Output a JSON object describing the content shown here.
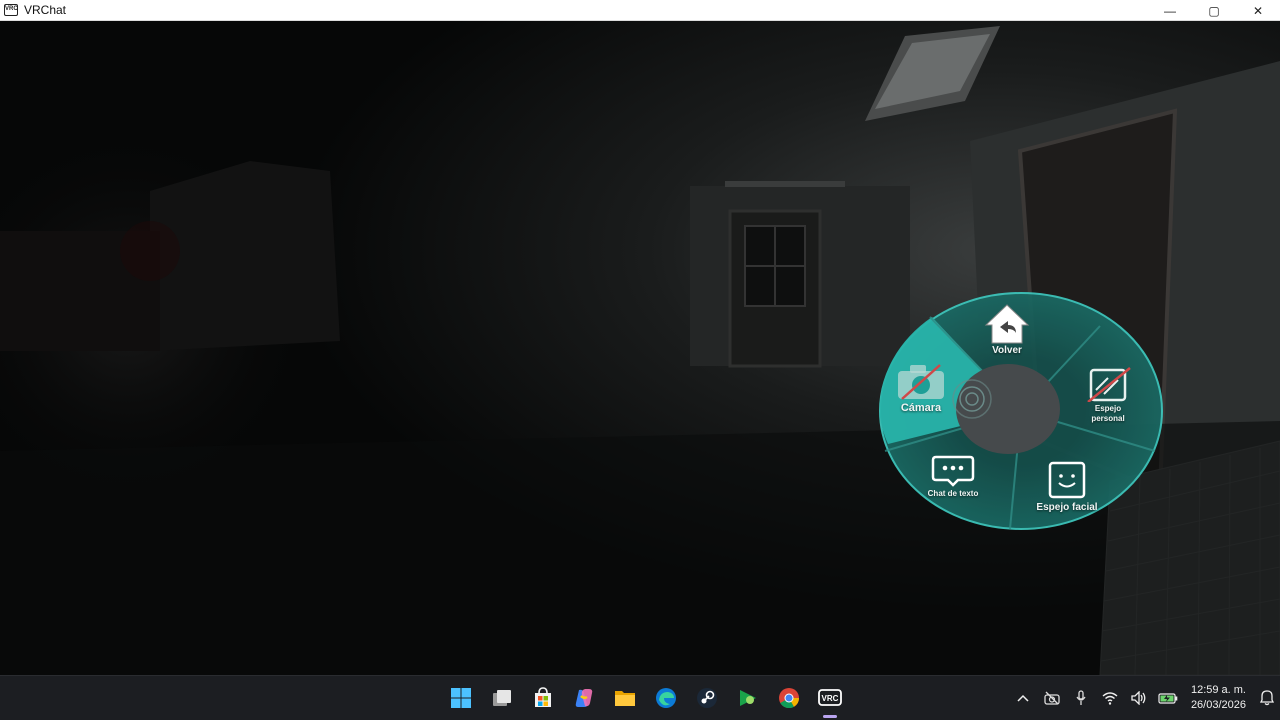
{
  "window": {
    "title": "VRChat",
    "icon_text": "VRC",
    "controls": {
      "minimize": "—",
      "maximize": "▢",
      "close": "✕"
    }
  },
  "radial_menu": {
    "accent_color": "#1f9e97",
    "items": {
      "back": "Volver",
      "camera": "Cámara",
      "personal_mirror_line1": "Espejo",
      "personal_mirror_line2": "personal",
      "text_chat": "Chat de texto",
      "face_mirror": "Espejo facial"
    },
    "highlighted": "camera"
  },
  "taskbar": {
    "pinned": [
      "start-icon",
      "task-view-icon",
      "microsoft-store-icon",
      "copilot-icon",
      "file-explorer-icon",
      "edge-icon",
      "steam-icon",
      "game-launcher-icon",
      "chrome-icon",
      "vrchat-icon"
    ],
    "active": "vrchat-icon",
    "tray": [
      "chevron-up-icon",
      "camera-off-icon",
      "microphone-icon",
      "wifi-icon",
      "volume-icon",
      "battery-icon"
    ],
    "clock": {
      "time": "12:59 a. m.",
      "date": "26/03/2026"
    }
  }
}
